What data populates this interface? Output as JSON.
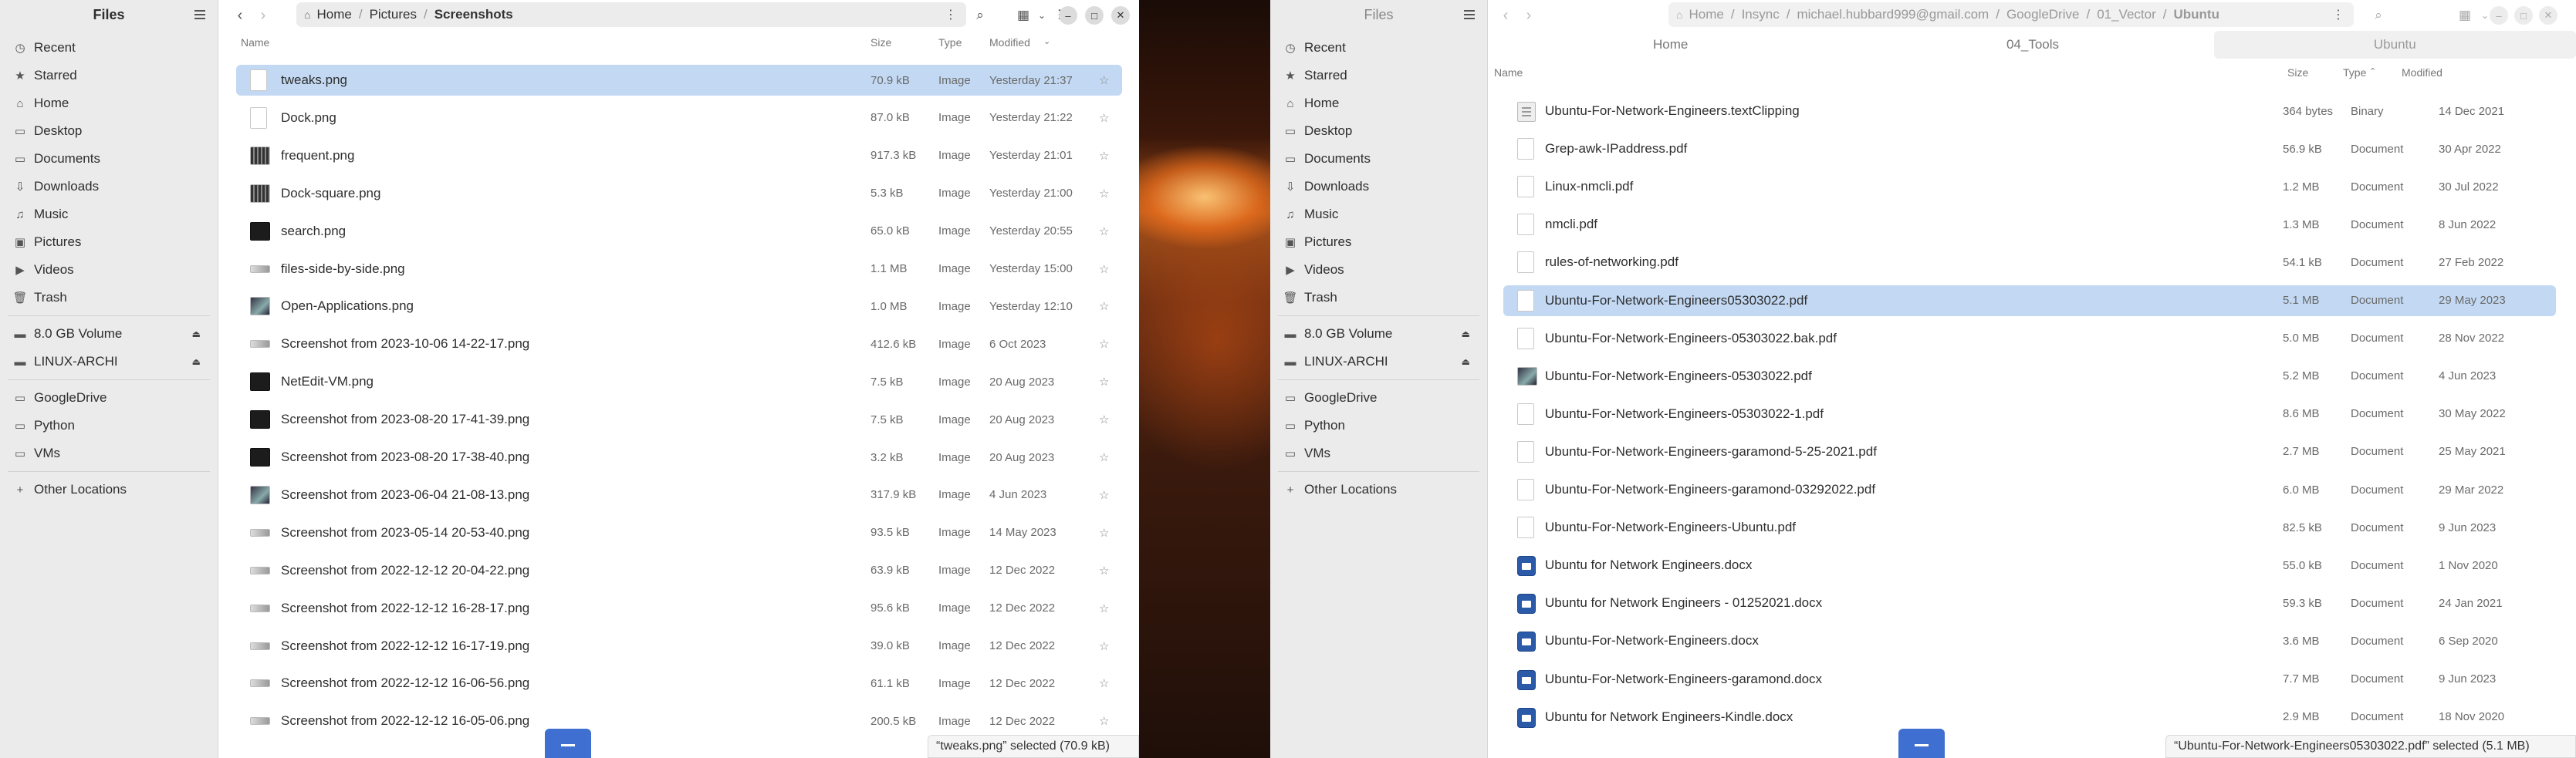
{
  "left": {
    "sidebar": {
      "title": "Files",
      "places": [
        {
          "label": "Recent",
          "icon": "clock-icon"
        },
        {
          "label": "Starred",
          "icon": "star-icon"
        },
        {
          "label": "Home",
          "icon": "home-icon"
        },
        {
          "label": "Desktop",
          "icon": "folder-icon"
        },
        {
          "label": "Documents",
          "icon": "folder-icon"
        },
        {
          "label": "Downloads",
          "icon": "download-icon"
        },
        {
          "label": "Music",
          "icon": "music-icon"
        },
        {
          "label": "Pictures",
          "icon": "image-icon"
        },
        {
          "label": "Videos",
          "icon": "video-icon"
        },
        {
          "label": "Trash",
          "icon": "trash-icon"
        }
      ],
      "devices": [
        {
          "label": "8.0 GB Volume",
          "icon": "drive-icon"
        },
        {
          "label": "LINUX-ARCHI",
          "icon": "drive-icon"
        }
      ],
      "bookmarks": [
        {
          "label": "GoogleDrive",
          "icon": "folder-icon"
        },
        {
          "label": "Python",
          "icon": "folder-icon"
        },
        {
          "label": "VMs",
          "icon": "folder-icon"
        }
      ],
      "other": "Other Locations"
    },
    "path": {
      "crumbs": [
        "Home",
        "Pictures",
        "Screenshots"
      ]
    },
    "columns": {
      "name": "Name",
      "size": "Size",
      "type": "Type",
      "modified": "Modified"
    },
    "rows": [
      {
        "name": "tweaks.png",
        "size": "70.9 kB",
        "type": "Image",
        "modified": "Yesterday 21:37",
        "thumb": "doc"
      },
      {
        "name": "Dock.png",
        "size": "87.0 kB",
        "type": "Image",
        "modified": "Yesterday 21:22",
        "thumb": "doc"
      },
      {
        "name": "frequent.png",
        "size": "917.3 kB",
        "type": "Image",
        "modified": "Yesterday 21:01",
        "thumb": "grid"
      },
      {
        "name": "Dock-square.png",
        "size": "5.3 kB",
        "type": "Image",
        "modified": "Yesterday 21:00",
        "thumb": "grid"
      },
      {
        "name": "search.png",
        "size": "65.0 kB",
        "type": "Image",
        "modified": "Yesterday 20:55",
        "thumb": "dark"
      },
      {
        "name": "files-side-by-side.png",
        "size": "1.1 MB",
        "type": "Image",
        "modified": "Yesterday 15:00",
        "thumb": "strip"
      },
      {
        "name": "Open-Applications.png",
        "size": "1.0 MB",
        "type": "Image",
        "modified": "Yesterday 12:10",
        "thumb": "photo"
      },
      {
        "name": "Screenshot from 2023-10-06 14-22-17.png",
        "size": "412.6 kB",
        "type": "Image",
        "modified": "6 Oct 2023",
        "thumb": "strip"
      },
      {
        "name": "NetEdit-VM.png",
        "size": "7.5 kB",
        "type": "Image",
        "modified": "20 Aug 2023",
        "thumb": "dark"
      },
      {
        "name": "Screenshot from 2023-08-20 17-41-39.png",
        "size": "7.5 kB",
        "type": "Image",
        "modified": "20 Aug 2023",
        "thumb": "dark"
      },
      {
        "name": "Screenshot from 2023-08-20 17-38-40.png",
        "size": "3.2 kB",
        "type": "Image",
        "modified": "20 Aug 2023",
        "thumb": "dark"
      },
      {
        "name": "Screenshot from 2023-06-04 21-08-13.png",
        "size": "317.9 kB",
        "type": "Image",
        "modified": "4 Jun 2023",
        "thumb": "photo"
      },
      {
        "name": "Screenshot from 2023-05-14 20-53-40.png",
        "size": "93.5 kB",
        "type": "Image",
        "modified": "14 May 2023",
        "thumb": "strip"
      },
      {
        "name": "Screenshot from 2022-12-12 20-04-22.png",
        "size": "63.9 kB",
        "type": "Image",
        "modified": "12 Dec 2022",
        "thumb": "strip"
      },
      {
        "name": "Screenshot from 2022-12-12 16-28-17.png",
        "size": "95.6 kB",
        "type": "Image",
        "modified": "12 Dec 2022",
        "thumb": "strip"
      },
      {
        "name": "Screenshot from 2022-12-12 16-17-19.png",
        "size": "39.0 kB",
        "type": "Image",
        "modified": "12 Dec 2022",
        "thumb": "strip"
      },
      {
        "name": "Screenshot from 2022-12-12 16-06-56.png",
        "size": "61.1 kB",
        "type": "Image",
        "modified": "12 Dec 2022",
        "thumb": "strip"
      },
      {
        "name": "Screenshot from 2022-12-12 16-05-06.png",
        "size": "200.5 kB",
        "type": "Image",
        "modified": "12 Dec 2022",
        "thumb": "strip"
      }
    ],
    "status": "“tweaks.png” selected (70.9 kB)"
  },
  "right": {
    "sidebar": {
      "title": "Files",
      "places": [
        {
          "label": "Recent",
          "icon": "clock-icon"
        },
        {
          "label": "Starred",
          "icon": "star-icon"
        },
        {
          "label": "Home",
          "icon": "home-icon"
        },
        {
          "label": "Desktop",
          "icon": "folder-icon"
        },
        {
          "label": "Documents",
          "icon": "folder-icon"
        },
        {
          "label": "Downloads",
          "icon": "download-icon"
        },
        {
          "label": "Music",
          "icon": "music-icon"
        },
        {
          "label": "Pictures",
          "icon": "image-icon"
        },
        {
          "label": "Videos",
          "icon": "video-icon"
        },
        {
          "label": "Trash",
          "icon": "trash-icon"
        }
      ],
      "devices": [
        {
          "label": "8.0 GB Volume",
          "icon": "drive-icon"
        },
        {
          "label": "LINUX-ARCHI",
          "icon": "drive-icon"
        }
      ],
      "bookmarks": [
        {
          "label": "GoogleDrive",
          "icon": "folder-icon"
        },
        {
          "label": "Python",
          "icon": "folder-icon"
        },
        {
          "label": "VMs",
          "icon": "folder-icon"
        }
      ],
      "other": "Other Locations"
    },
    "path": {
      "crumbs": [
        "Home",
        "Insync",
        "michael.hubbard999@gmail.com",
        "GoogleDrive",
        "01_Vector",
        "Ubuntu"
      ]
    },
    "tabs": [
      "Home",
      "04_Tools",
      "Ubuntu"
    ],
    "columns": {
      "name": "Name",
      "size": "Size",
      "type": "Type",
      "modified": "Modified"
    },
    "rows": [
      {
        "name": "Ubuntu-For-Network-Engineers.textClipping",
        "size": "364 bytes",
        "type": "Binary",
        "modified": "14 Dec 2021",
        "thumb": "clip"
      },
      {
        "name": "Grep-awk-IPaddress.pdf",
        "size": "56.9 kB",
        "type": "Document",
        "modified": "30 Apr 2022",
        "thumb": "doc"
      },
      {
        "name": "Linux-nmcli.pdf",
        "size": "1.2 MB",
        "type": "Document",
        "modified": "30 Jul 2022",
        "thumb": "doc"
      },
      {
        "name": "nmcli.pdf",
        "size": "1.3 MB",
        "type": "Document",
        "modified": "8 Jun 2022",
        "thumb": "doc"
      },
      {
        "name": "rules-of-networking.pdf",
        "size": "54.1 kB",
        "type": "Document",
        "modified": "27 Feb 2022",
        "thumb": "doc"
      },
      {
        "name": "Ubuntu-For-Network-Engineers05303022.pdf",
        "size": "5.1 MB",
        "type": "Document",
        "modified": "29 May 2023",
        "thumb": "doc"
      },
      {
        "name": "Ubuntu-For-Network-Engineers-05303022.bak.pdf",
        "size": "5.0 MB",
        "type": "Document",
        "modified": "28 Nov 2022",
        "thumb": "doc"
      },
      {
        "name": "Ubuntu-For-Network-Engineers-05303022.pdf",
        "size": "5.2 MB",
        "type": "Document",
        "modified": "4 Jun 2023",
        "thumb": "photo"
      },
      {
        "name": "Ubuntu-For-Network-Engineers-05303022-1.pdf",
        "size": "8.6 MB",
        "type": "Document",
        "modified": "30 May 2022",
        "thumb": "doc"
      },
      {
        "name": "Ubuntu-For-Network-Engineers-garamond-5-25-2021.pdf",
        "size": "2.7 MB",
        "type": "Document",
        "modified": "25 May 2021",
        "thumb": "doc"
      },
      {
        "name": "Ubuntu-For-Network-Engineers-garamond-03292022.pdf",
        "size": "6.0 MB",
        "type": "Document",
        "modified": "29 Mar 2022",
        "thumb": "doc"
      },
      {
        "name": "Ubuntu-For-Network-Engineers-Ubuntu.pdf",
        "size": "82.5 kB",
        "type": "Document",
        "modified": "9 Jun 2023",
        "thumb": "doc"
      },
      {
        "name": "Ubuntu for Network Engineers.docx",
        "size": "55.0 kB",
        "type": "Document",
        "modified": "1 Nov 2020",
        "thumb": "word"
      },
      {
        "name": "Ubuntu for Network Engineers - 01252021.docx",
        "size": "59.3 kB",
        "type": "Document",
        "modified": "24 Jan 2021",
        "thumb": "word"
      },
      {
        "name": "Ubuntu-For-Network-Engineers.docx",
        "size": "3.6 MB",
        "type": "Document",
        "modified": "6 Sep 2020",
        "thumb": "word"
      },
      {
        "name": "Ubuntu-For-Network-Engineers-garamond.docx",
        "size": "7.7 MB",
        "type": "Document",
        "modified": "9 Jun 2023",
        "thumb": "word"
      },
      {
        "name": "Ubuntu for Network Engineers-Kindle.docx",
        "size": "2.9 MB",
        "type": "Document",
        "modified": "18 Nov 2020",
        "thumb": "word"
      }
    ],
    "status": "“Ubuntu-For-Network-Engineers05303022.pdf” selected (5.1 MB)"
  }
}
